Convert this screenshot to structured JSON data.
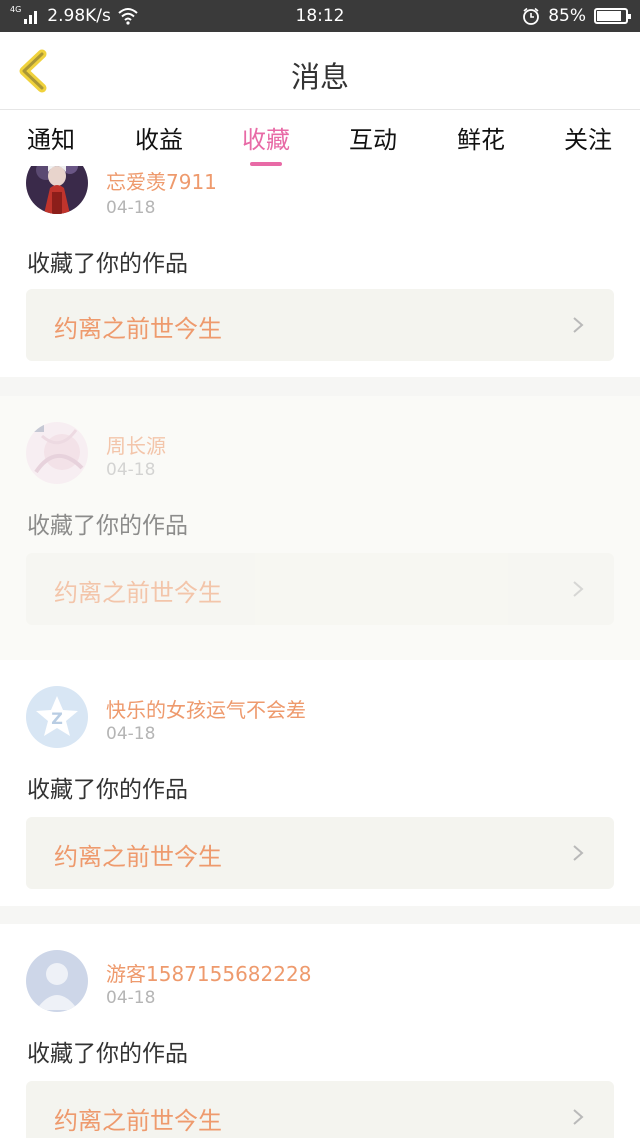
{
  "status_bar": {
    "network_type": "4G",
    "speed": "2.98K/s",
    "time": "18:12",
    "battery_percent": "85%",
    "battery_level": 0.85
  },
  "nav": {
    "title": "消息"
  },
  "tabs": [
    {
      "label": "通知"
    },
    {
      "label": "收益"
    },
    {
      "label": "收藏",
      "active": true
    },
    {
      "label": "互动"
    },
    {
      "label": "鲜花"
    },
    {
      "label": "关注"
    }
  ],
  "colors": {
    "accent_pink": "#e86aa6",
    "name_orange": "#ee9a6d"
  },
  "messages": [
    {
      "user": "忘爱羡7911",
      "date": "04-18",
      "action": "收藏了你的作品",
      "work": "约离之前世今生"
    },
    {
      "user": "周长源",
      "date": "04-18",
      "action": "收藏了你的作品",
      "work": "约离之前世今生"
    },
    {
      "user": "快乐的女孩运气不会差",
      "date": "04-18",
      "action": "收藏了你的作品",
      "work": "约离之前世今生"
    },
    {
      "user": "游客1587155682228",
      "date": "04-18",
      "action": "收藏了你的作品",
      "work": "约离之前世今生"
    }
  ]
}
